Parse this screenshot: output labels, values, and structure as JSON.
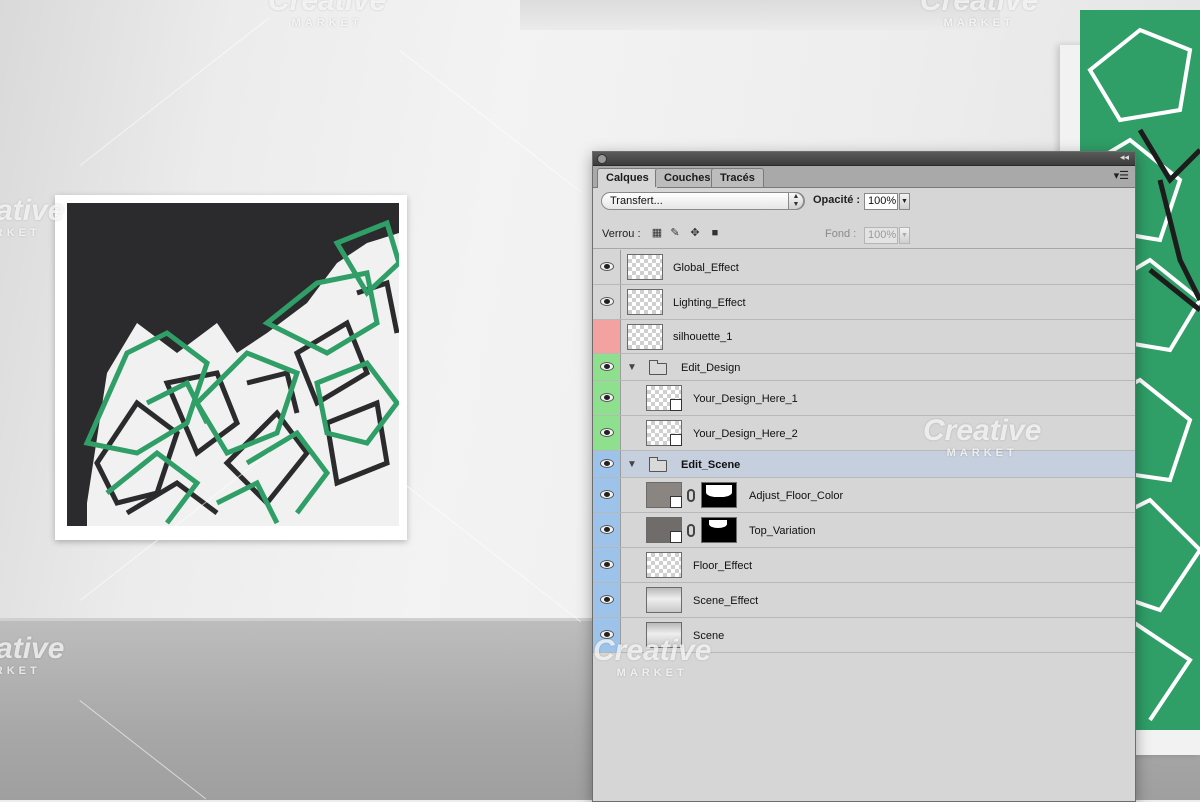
{
  "watermark": {
    "brand": "Creative",
    "sub": "MARKET"
  },
  "panel": {
    "tabs": [
      "Calques",
      "Couches",
      "Tracés"
    ],
    "blend_mode": "Transfert...",
    "opacity_label": "Opacité :",
    "opacity_value": "100%",
    "lock_label": "Verrou :",
    "fill_label": "Fond :",
    "fill_value": "100%"
  },
  "layers": [
    {
      "name": "Global_Effect",
      "label_color": null,
      "visible": true,
      "kind": "layer"
    },
    {
      "name": "Lighting_Effect",
      "label_color": null,
      "visible": true,
      "kind": "layer"
    },
    {
      "name": "silhouette_1",
      "label_color": "#f3a1a1",
      "visible": false,
      "kind": "layer"
    },
    {
      "name": "Edit_Design",
      "label_color": "#8ee08e",
      "visible": true,
      "kind": "group"
    },
    {
      "name": "Your_Design_Here_1",
      "label_color": "#8ee08e",
      "visible": true,
      "kind": "smart-object"
    },
    {
      "name": "Your_Design_Here_2",
      "label_color": "#8ee08e",
      "visible": true,
      "kind": "smart-object"
    },
    {
      "name": "Edit_Scene",
      "label_color": "#9ec3ea",
      "visible": true,
      "kind": "group",
      "selected": true
    },
    {
      "name": "Adjust_Floor_Color",
      "label_color": "#9ec3ea",
      "visible": true,
      "kind": "masked-smart-object"
    },
    {
      "name": "Top_Variation",
      "label_color": "#9ec3ea",
      "visible": true,
      "kind": "masked-smart-object"
    },
    {
      "name": "Floor_Effect",
      "label_color": "#9ec3ea",
      "visible": true,
      "kind": "layer"
    },
    {
      "name": "Scene_Effect",
      "label_color": "#9ec3ea",
      "visible": true,
      "kind": "layer"
    },
    {
      "name": "Scene",
      "label_color": "#9ec3ea",
      "visible": true,
      "kind": "layer"
    }
  ],
  "colors": {
    "art_green": "#2f9e67",
    "art_dark": "#2b2a2c",
    "panel_bg": "#d6d6d6",
    "selected_row": "#c5cfdd"
  }
}
